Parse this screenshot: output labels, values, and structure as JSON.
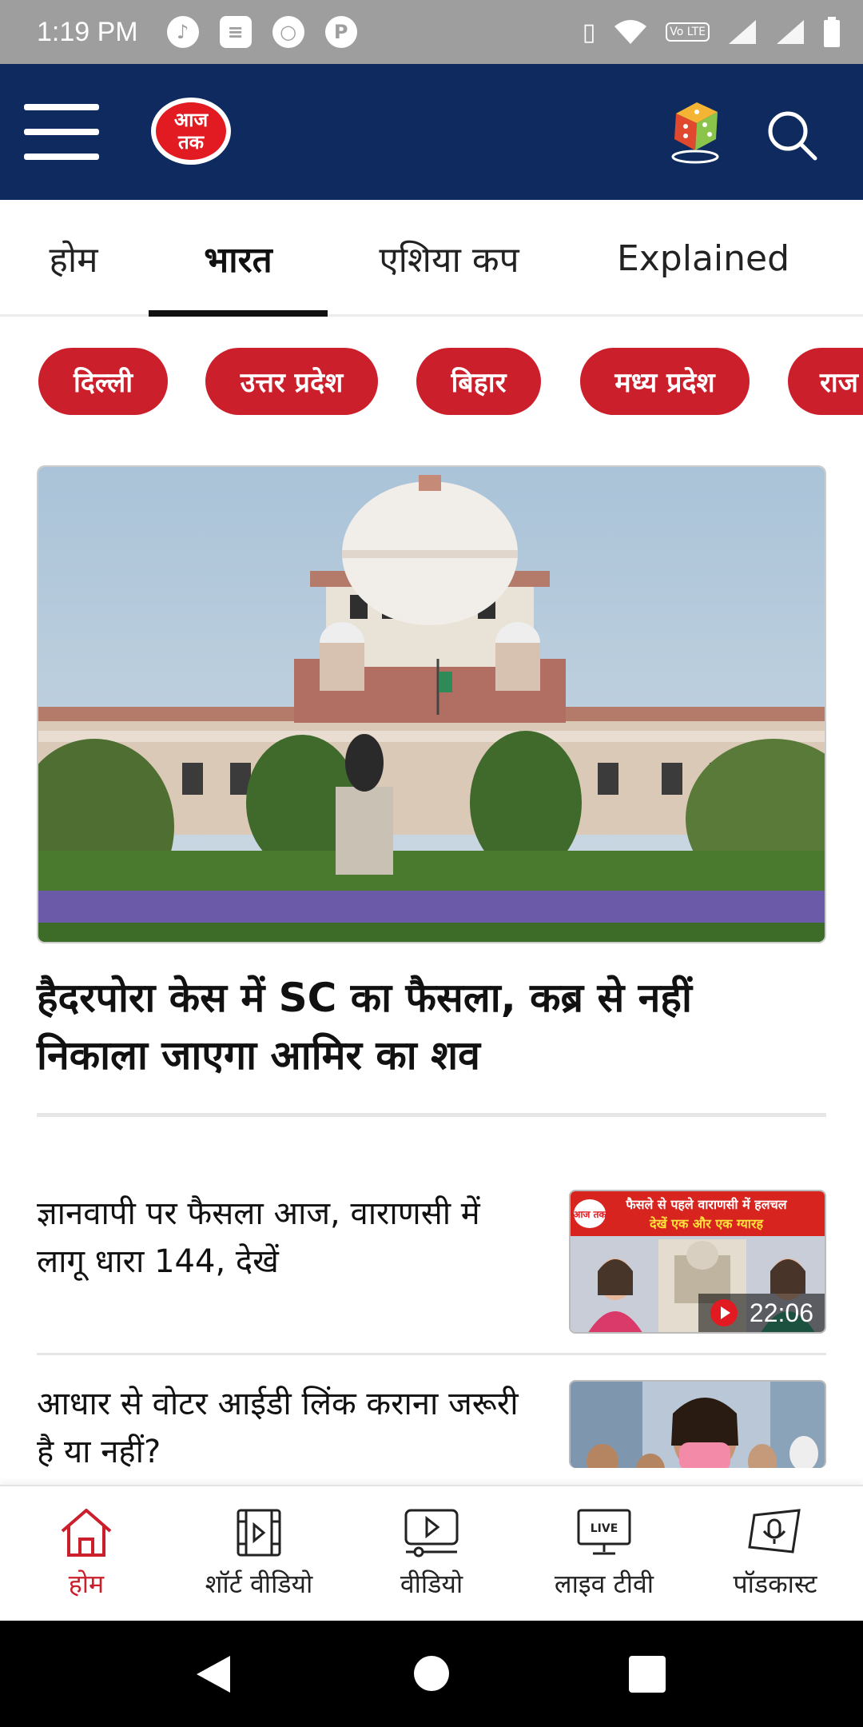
{
  "status_bar": {
    "time": "1:19 PM",
    "left_icons": [
      "music-icon",
      "news-icon",
      "chat-icon",
      "p-icon"
    ],
    "right_icons": [
      "vibrate-icon",
      "wifi-icon",
      "volte-icon",
      "signal-icon",
      "signal-icon-2",
      "battery-icon"
    ],
    "volte_label": "Vo LTE"
  },
  "header": {
    "logo_text": "आज तक",
    "background": "#0f2a5e"
  },
  "tabs": [
    {
      "label": "होम",
      "active": false
    },
    {
      "label": "भारत",
      "active": true
    },
    {
      "label": "एशिया कप",
      "active": false
    },
    {
      "label": "Explained",
      "active": false
    }
  ],
  "chips": [
    "दिल्ली",
    "उत्तर प्रदेश",
    "बिहार",
    "मध्य प्रदेश",
    "राज"
  ],
  "hero": {
    "title": "हैदरपोरा केस में SC का फैसला, कब्र से नहीं निकाला जाएगा आमिर का शव",
    "image": "supreme-court-building"
  },
  "list": [
    {
      "title": "ज्ञानवापी पर फैसला आज, वाराणसी में लागू धारा 144, देखें",
      "thumb_banner_line1": "फैसले से पहले वाराणसी में हलचल",
      "thumb_banner_line2": "देखें एक और एक ग्यारह",
      "thumb_logo": "आज तक",
      "duration": "22:06"
    },
    {
      "title": "आधार से वोटर आईडी लिंक कराना जरूरी है या नहीं?"
    }
  ],
  "bottom_nav": [
    {
      "label": "होम",
      "icon": "home-icon",
      "active": true
    },
    {
      "label": "शॉर्ट वीडियो",
      "icon": "short-video-icon",
      "active": false
    },
    {
      "label": "वीडियो",
      "icon": "video-icon",
      "active": false
    },
    {
      "label": "लाइव टीवी",
      "icon": "live-tv-icon",
      "active": false,
      "badge": "LIVE"
    },
    {
      "label": "पॉडकास्ट",
      "icon": "podcast-icon",
      "active": false
    }
  ],
  "colors": {
    "brand_red": "#cc1f2c",
    "header_navy": "#0f2a5e"
  }
}
